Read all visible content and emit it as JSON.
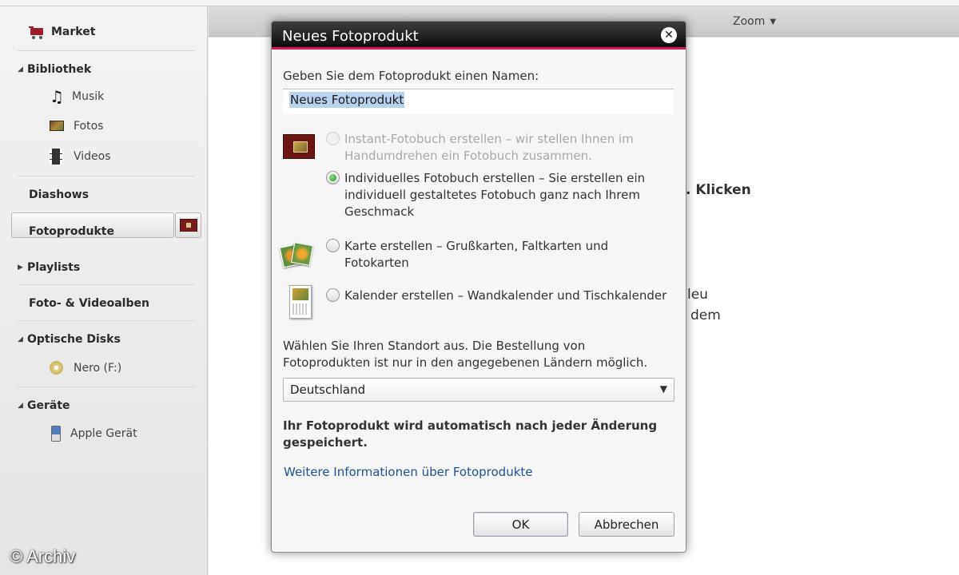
{
  "sidebar": {
    "market": "Market",
    "bibliothek": "Bibliothek",
    "musik": "Musik",
    "fotos": "Fotos",
    "videos": "Videos",
    "diashows": "Diashows",
    "fotoprodukte": "Fotoprodukte",
    "playlists": "Playlists",
    "fotoalben": "Foto- & Videoalben",
    "optische_disks": "Optische Disks",
    "nero": "Nero (F:)",
    "geraete": "Geräte",
    "apple": "Apple Gerät"
  },
  "toolbar": {
    "zoom": "Zoom"
  },
  "background": {
    "klicken": ". Klicken",
    "neu": "leu",
    "dem": "dem"
  },
  "dialog": {
    "title": "Neues Fotoprodukt",
    "close_icon": "close-icon",
    "name_prompt": "Geben Sie dem Fotoprodukt einen Namen:",
    "name_value": "Neues Fotoprodukt",
    "options": {
      "instant": "Instant-Fotobuch erstellen – wir stellen Ihnen im Handumdrehen ein Fotobuch zusammen.",
      "individuell": "Individuelles Fotobuch erstellen – Sie erstellen ein individuell gestaltetes Fotobuch ganz nach Ihrem Geschmack",
      "karte": "Karte erstellen – Grußkarten, Faltkarten und Fotokarten",
      "kalender": "Kalender erstellen – Wandkalender und Tischkalender"
    },
    "selected_option": "individuell",
    "location_prompt": "Wählen Sie Ihren Standort aus. Die Bestellung von Fotoprodukten ist nur in den angegebenen Ländern möglich.",
    "location_value": "Deutschland",
    "autosave_note": "Ihr Fotoprodukt wird automatisch nach jeder Änderung gespeichert.",
    "info_link": "Weitere Informationen über Fotoprodukte",
    "ok_label": "OK",
    "cancel_label": "Abbrechen"
  },
  "watermark": "© Archiv",
  "colors": {
    "accent": "#d6145a",
    "radio_selected": "#1f8f2a",
    "link": "#1e4f9a"
  }
}
